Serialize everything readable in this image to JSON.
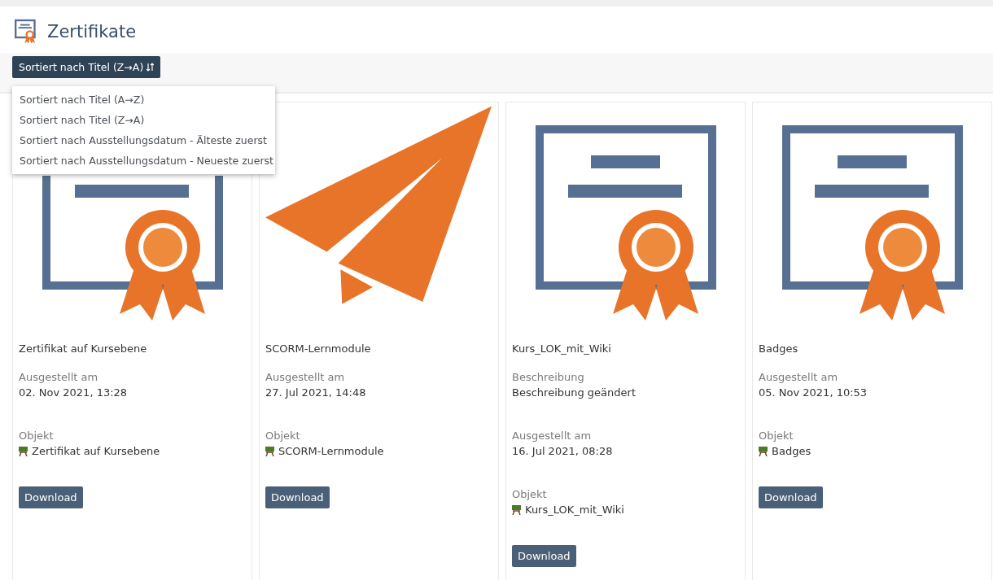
{
  "header": {
    "title": "Zertifikate"
  },
  "sort": {
    "label": "Sortiert nach Titel (Z→A)",
    "expanded": true,
    "options": [
      {
        "label": "Sortiert nach Titel (A→Z)"
      },
      {
        "label": "Sortiert nach Titel (Z→A)"
      },
      {
        "label": "Sortiert nach Ausstellungsdatum - Älteste zuerst"
      },
      {
        "label": "Sortiert nach Ausstellungsdatum - Neueste zuerst"
      }
    ]
  },
  "cards": [
    {
      "kind": "certificate",
      "title": "Zertifikat auf Kursebene",
      "fields": [
        {
          "kind": "text",
          "label": "Ausgestellt am",
          "value": "02. Nov 2021, 13:28"
        },
        {
          "kind": "object",
          "label": "Objekt",
          "value": "Zertifikat auf Kursebene"
        }
      ],
      "button": "Download"
    },
    {
      "kind": "plane",
      "title": "SCORM-Lernmodule",
      "fields": [
        {
          "kind": "text",
          "label": "Ausgestellt am",
          "value": "27. Jul 2021, 14:48"
        },
        {
          "kind": "object",
          "label": "Objekt",
          "value": "SCORM-Lernmodule"
        }
      ],
      "button": "Download"
    },
    {
      "kind": "certificate",
      "title": "Kurs_LOK_mit_Wiki",
      "fields": [
        {
          "kind": "text",
          "label": "Beschreibung",
          "value": "Beschreibung geändert"
        },
        {
          "kind": "text",
          "label": "Ausgestellt am",
          "value": "16. Jul 2021, 08:28"
        },
        {
          "kind": "object",
          "label": "Objekt",
          "value": "Kurs_LOK_mit_Wiki"
        }
      ],
      "button": "Download"
    },
    {
      "kind": "certificate",
      "title": "Badges",
      "fields": [
        {
          "kind": "text",
          "label": "Ausgestellt am",
          "value": "05. Nov 2021, 10:53"
        },
        {
          "kind": "object",
          "label": "Objekt",
          "value": "Badges"
        }
      ],
      "button": "Download"
    }
  ]
}
